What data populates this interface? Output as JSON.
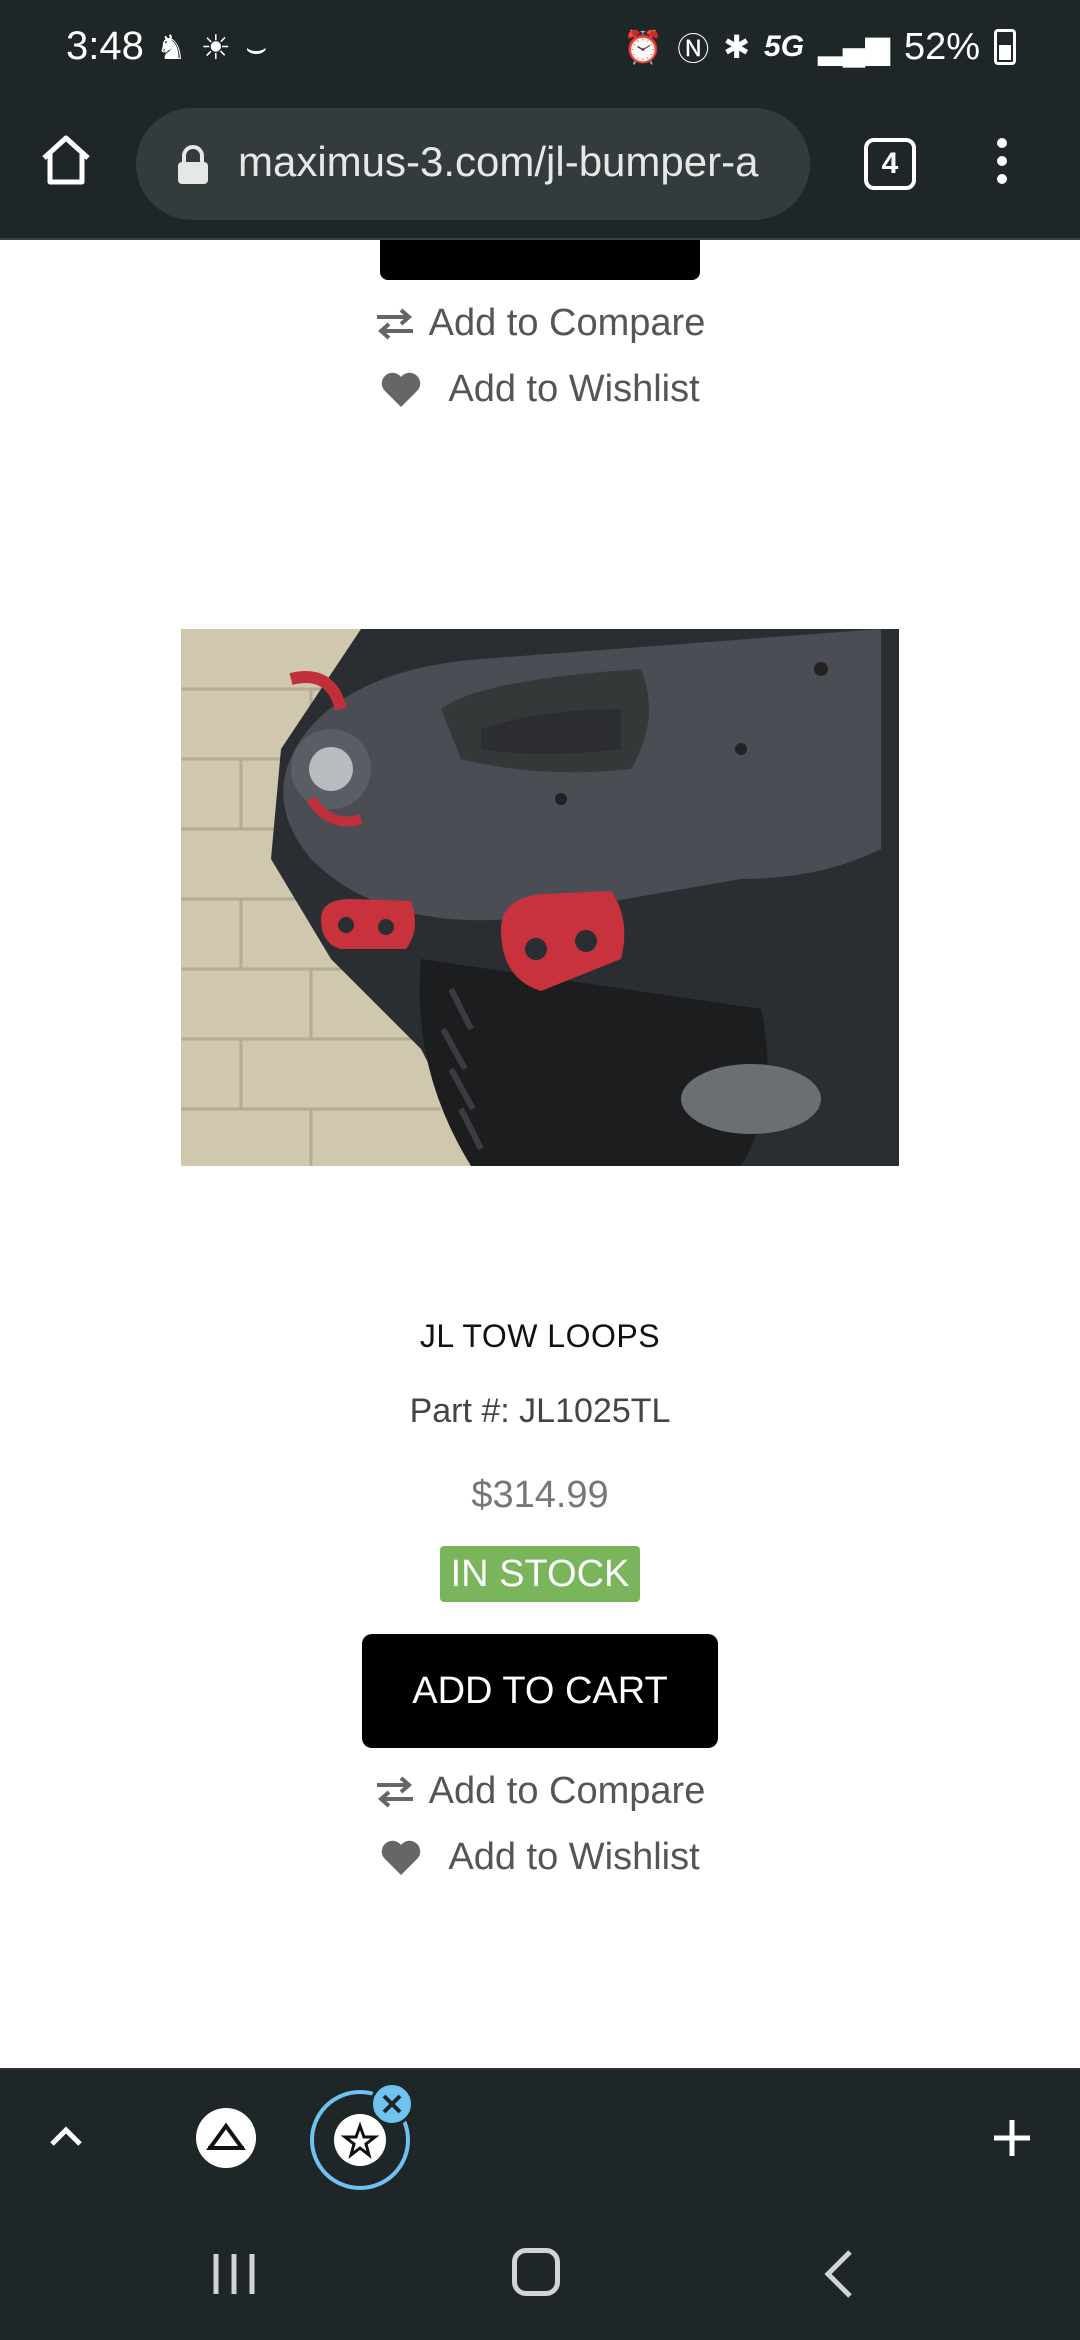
{
  "status_bar": {
    "time": "3:48",
    "battery": "52%",
    "network": "5G"
  },
  "browser": {
    "url": "maximus-3.com/jl-bumper-a",
    "tab_count": "4"
  },
  "previous_product": {
    "compare_label": "Add to Compare",
    "wishlist_label": "Add to Wishlist"
  },
  "product": {
    "title": "JL TOW LOOPS",
    "part_number": "Part #: JL1025TL",
    "price": "$314.99",
    "stock_status": "IN STOCK",
    "add_to_cart_label": "ADD TO CART",
    "compare_label": "Add to Compare",
    "wishlist_label": "Add to Wishlist"
  },
  "colors": {
    "stock_green": "#7ab55c",
    "toolbar_bg": "#1f2628",
    "tab_ring": "#6ec3f0"
  }
}
